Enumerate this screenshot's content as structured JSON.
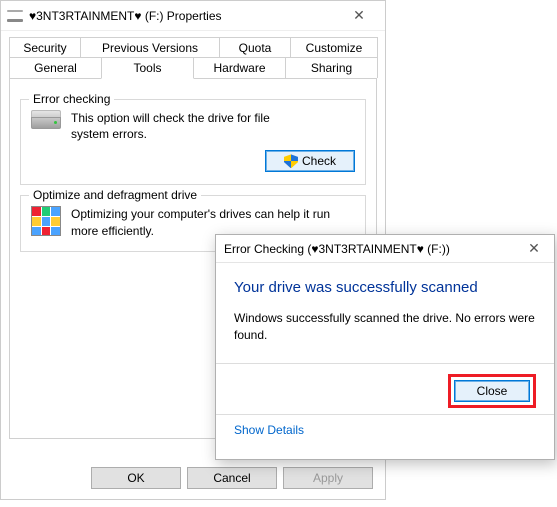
{
  "properties": {
    "title": "♥3NT3RTAINMENT♥ (F:) Properties",
    "tabs_row1": [
      "Security",
      "Previous Versions",
      "Quota",
      "Customize"
    ],
    "tabs_row2": [
      "General",
      "Tools",
      "Hardware",
      "Sharing"
    ],
    "active_tab": "Tools",
    "error_checking": {
      "legend": "Error checking",
      "text": "This option will check the drive for file system errors.",
      "button": "Check"
    },
    "defrag": {
      "legend": "Optimize and defragment drive",
      "text": "Optimizing your computer's drives can help it run more efficiently."
    },
    "buttons": {
      "ok": "OK",
      "cancel": "Cancel",
      "apply": "Apply"
    }
  },
  "dialog": {
    "title": "Error Checking (♥3NT3RTAINMENT♥ (F:))",
    "heading": "Your drive was successfully scanned",
    "message": "Windows successfully scanned the drive. No errors were found.",
    "close": "Close",
    "show_details": "Show Details"
  }
}
